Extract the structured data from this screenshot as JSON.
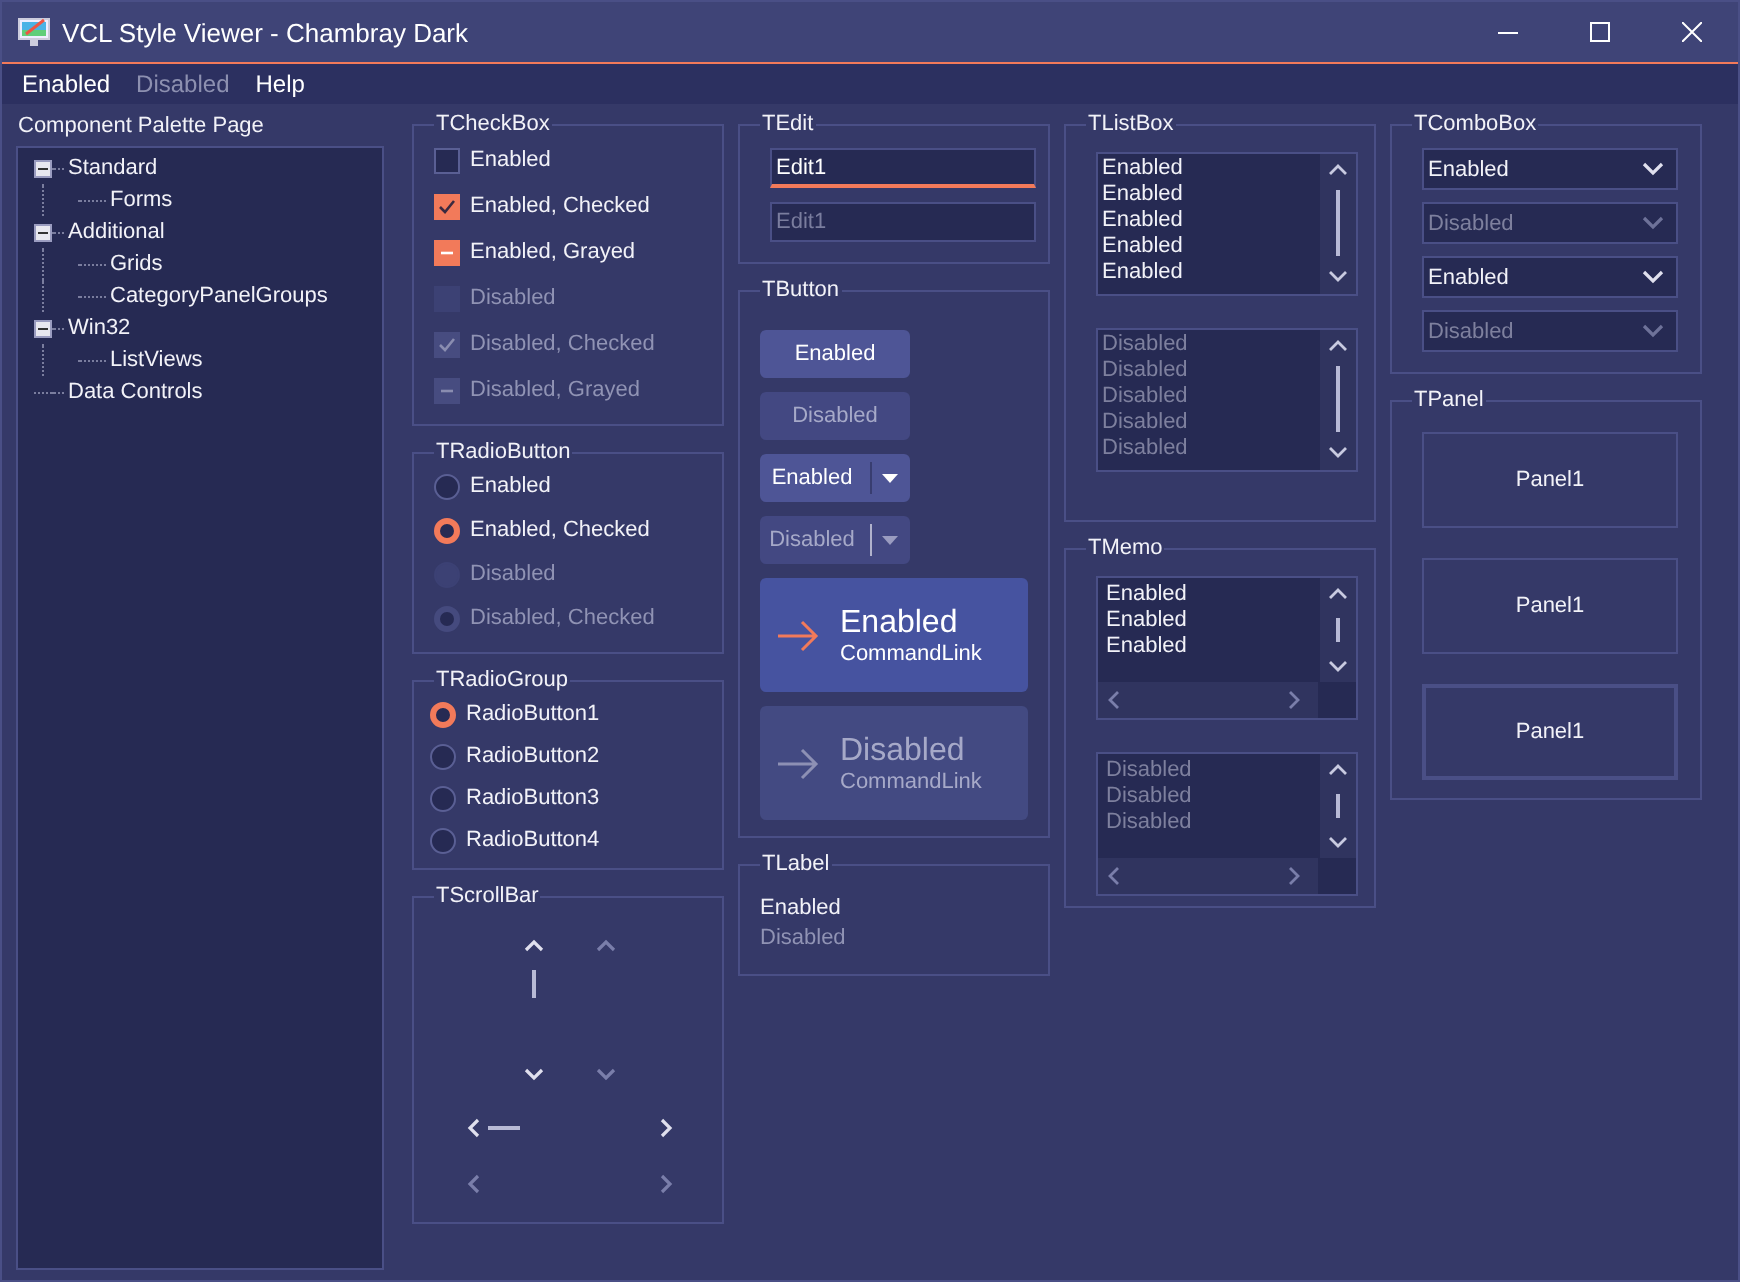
{
  "window": {
    "title": "VCL Style Viewer - Chambray Dark"
  },
  "menu": [
    {
      "label": "Enabled",
      "disabled": false
    },
    {
      "label": "Disabled",
      "disabled": true
    },
    {
      "label": "Help",
      "disabled": false
    }
  ],
  "palette": {
    "label": "Component Palette Page",
    "tree": [
      {
        "label": "Standard",
        "expanded": true,
        "children": [
          {
            "label": "Forms"
          }
        ]
      },
      {
        "label": "Additional",
        "expanded": true,
        "children": [
          {
            "label": "Grids"
          },
          {
            "label": "CategoryPanelGroups"
          }
        ]
      },
      {
        "label": "Win32",
        "expanded": true,
        "children": [
          {
            "label": "ListViews"
          }
        ]
      },
      {
        "label": "Data Controls"
      }
    ]
  },
  "checkboxes": {
    "title": "TCheckBox",
    "items": [
      {
        "label": "Enabled",
        "checked": false,
        "grayed": false,
        "disabled": false
      },
      {
        "label": "Enabled, Checked",
        "checked": true,
        "grayed": false,
        "disabled": false
      },
      {
        "label": "Enabled, Grayed",
        "checked": true,
        "grayed": true,
        "disabled": false
      },
      {
        "label": "Disabled",
        "checked": false,
        "grayed": false,
        "disabled": true
      },
      {
        "label": "Disabled, Checked",
        "checked": true,
        "grayed": false,
        "disabled": true
      },
      {
        "label": "Disabled, Grayed",
        "checked": true,
        "grayed": true,
        "disabled": true
      }
    ]
  },
  "radio_buttons": {
    "title": "TRadioButton",
    "items": [
      {
        "label": "Enabled",
        "selected": false,
        "disabled": false
      },
      {
        "label": "Enabled, Checked",
        "selected": true,
        "disabled": false
      },
      {
        "label": "Disabled",
        "selected": false,
        "disabled": true
      },
      {
        "label": "Disabled, Checked",
        "selected": true,
        "disabled": true
      }
    ]
  },
  "radio_group": {
    "title": "TRadioGroup",
    "items": [
      {
        "label": "RadioButton1",
        "selected": true
      },
      {
        "label": "RadioButton2",
        "selected": false
      },
      {
        "label": "RadioButton3",
        "selected": false
      },
      {
        "label": "RadioButton4",
        "selected": false
      }
    ]
  },
  "scrollbar": {
    "title": "TScrollBar"
  },
  "edit": {
    "title": "TEdit",
    "fields": [
      {
        "value": "Edit1",
        "disabled": false,
        "focused": true
      },
      {
        "value": "Edit1",
        "disabled": true,
        "focused": false
      }
    ]
  },
  "buttons": {
    "title": "TButton",
    "items": [
      {
        "kind": "push",
        "label": "Enabled",
        "disabled": false
      },
      {
        "kind": "push",
        "label": "Disabled",
        "disabled": true
      },
      {
        "kind": "split",
        "label": "Enabled",
        "disabled": false
      },
      {
        "kind": "split",
        "label": "Disabled",
        "disabled": true
      },
      {
        "kind": "command_link",
        "label": "Enabled",
        "note": "CommandLink",
        "disabled": false
      },
      {
        "kind": "command_link",
        "label": "Disabled",
        "note": "CommandLink",
        "disabled": true
      }
    ]
  },
  "label": {
    "title": "TLabel",
    "items": [
      {
        "text": "Enabled",
        "disabled": false
      },
      {
        "text": "Disabled",
        "disabled": true
      }
    ]
  },
  "listbox": {
    "title": "TListBox",
    "lists": [
      {
        "disabled": false,
        "items": [
          "Enabled",
          "Enabled",
          "Enabled",
          "Enabled",
          "Enabled"
        ]
      },
      {
        "disabled": true,
        "items": [
          "Disabled",
          "Disabled",
          "Disabled",
          "Disabled",
          "Disabled"
        ]
      }
    ]
  },
  "memo": {
    "title": "TMemo",
    "memos": [
      {
        "disabled": false,
        "lines": [
          "Enabled",
          "Enabled",
          "Enabled"
        ]
      },
      {
        "disabled": true,
        "lines": [
          "Disabled",
          "Disabled",
          "Disabled"
        ]
      }
    ]
  },
  "combobox": {
    "title": "TComboBox",
    "items": [
      {
        "value": "Enabled",
        "disabled": false
      },
      {
        "value": "Disabled",
        "disabled": true
      },
      {
        "value": "Enabled",
        "disabled": false
      },
      {
        "value": "Disabled",
        "disabled": true
      }
    ]
  },
  "panel": {
    "title": "TPanel",
    "items": [
      {
        "caption": "Panel1",
        "kind": "single"
      },
      {
        "caption": "Panel1",
        "kind": "single"
      },
      {
        "caption": "Panel1",
        "kind": "double"
      }
    ]
  }
}
